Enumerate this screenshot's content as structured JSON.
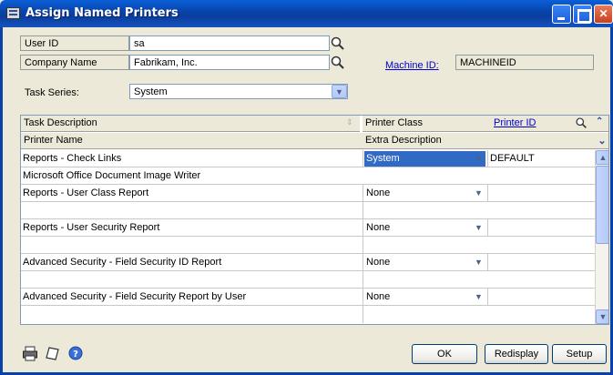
{
  "window": {
    "title": "Assign Named Printers"
  },
  "form": {
    "user_id_label": "User ID",
    "user_id_value": "sa",
    "company_label": "Company Name",
    "company_value": "Fabrikam, Inc.",
    "machine_label": "Machine ID:",
    "machine_value": "MACHINEID",
    "task_series_label": "Task Series:",
    "task_series_value": "System"
  },
  "grid": {
    "headers": {
      "task_description": "Task Description",
      "printer_class": "Printer Class",
      "printer_id": "Printer ID",
      "printer_name": "Printer Name",
      "extra_description": "Extra Description"
    },
    "rows": [
      {
        "description": "Reports - Check Links",
        "printer_class": "System",
        "printer_id": "DEFAULT",
        "selected": true
      },
      {
        "description": "Microsoft Office Document Image Writer"
      },
      {
        "description": "Reports - User Class Report",
        "printer_class": "None",
        "printer_id": ""
      },
      {
        "description": ""
      },
      {
        "description": "Reports - User Security Report",
        "printer_class": "None",
        "printer_id": ""
      },
      {
        "description": ""
      },
      {
        "description": "Advanced Security - Field Security ID Report",
        "printer_class": "None",
        "printer_id": ""
      },
      {
        "description": ""
      },
      {
        "description": "Advanced Security - Field Security Report by User",
        "printer_class": "None",
        "printer_id": ""
      },
      {
        "description": ""
      }
    ]
  },
  "buttons": {
    "ok": "OK",
    "redisplay": "Redisplay",
    "setup": "Setup"
  },
  "colors": {
    "titlebar": "#0a3d9c",
    "selection": "#316ac5",
    "link": "#0000cc"
  }
}
